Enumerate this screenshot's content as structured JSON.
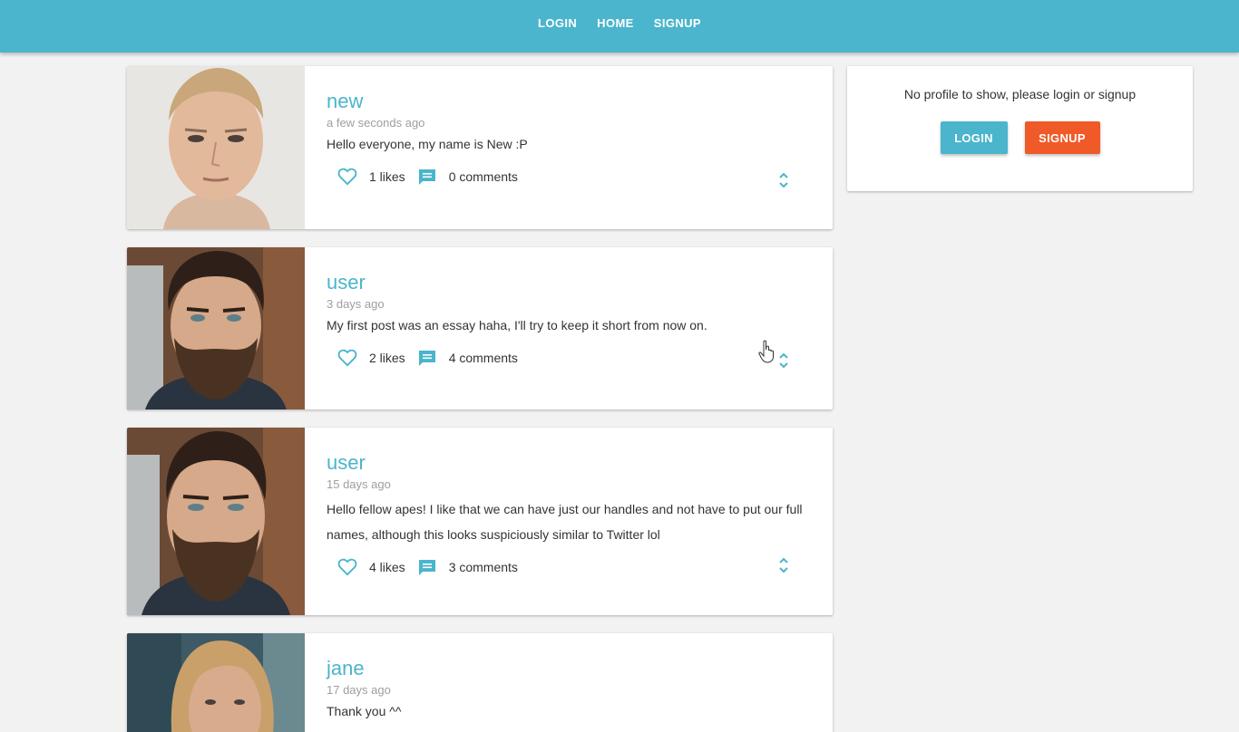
{
  "nav": {
    "links": [
      "LOGIN",
      "HOME",
      "SIGNUP"
    ]
  },
  "colors": {
    "primary": "#4ab5cc",
    "accent": "#f05a28",
    "background": "#f2f2f2"
  },
  "posts": [
    {
      "handle": "new",
      "time": "a few seconds ago",
      "body": "Hello everyone, my name is New :P",
      "likes": "1 likes",
      "comments": "0 comments"
    },
    {
      "handle": "user",
      "time": "3 days ago",
      "body": "My first post was an essay haha, I'll try to keep it short from now on.",
      "likes": "2 likes",
      "comments": "4 comments"
    },
    {
      "handle": "user",
      "time": "15 days ago",
      "body": "Hello fellow apes! I like that we can have just our handles and not have to put our full names, although this looks suspiciously similar to Twitter lol",
      "likes": "4 likes",
      "comments": "3 comments"
    },
    {
      "handle": "jane",
      "time": "17 days ago",
      "body": "Thank you ^^"
    }
  ],
  "sidebar": {
    "message": "No profile to show, please login or signup",
    "login_label": "LOGIN",
    "signup_label": "SIGNUP"
  },
  "icons": {
    "like": "heart-outline-icon",
    "comment": "chat-bubble-icon",
    "expand": "unfold-more-icon",
    "cursor": "hand-pointer-icon"
  }
}
